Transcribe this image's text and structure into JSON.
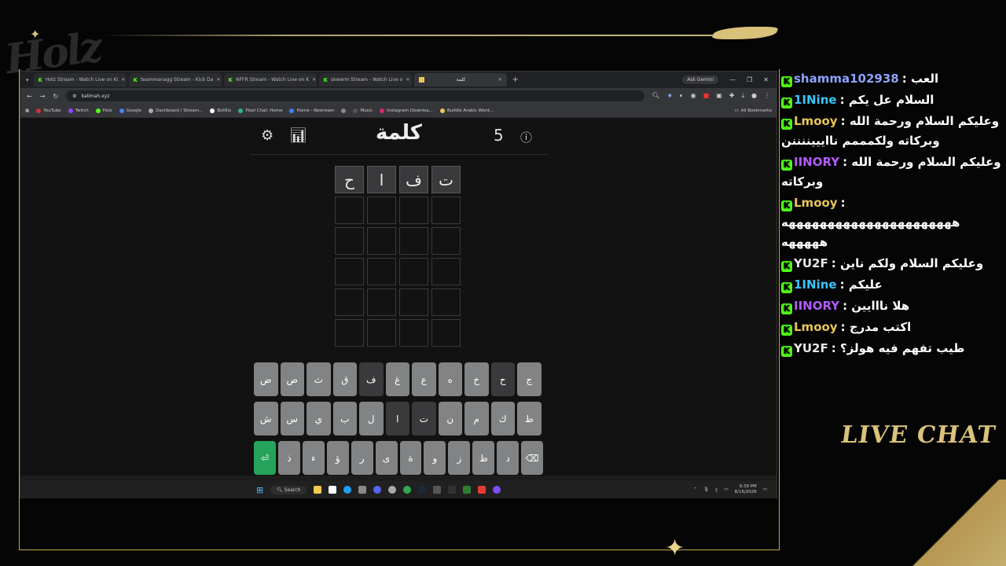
{
  "browser": {
    "tabs": [
      {
        "label": "Holz Stream - Watch Live on Ki",
        "active": false
      },
      {
        "label": "teammanagg Stream - Kick Da",
        "active": false
      },
      {
        "label": "NFFR Stream - Watch Live on K",
        "active": false
      },
      {
        "label": "skwerm Stream - Watch Live o",
        "active": false
      },
      {
        "label": "كلمة",
        "active": true
      }
    ],
    "gemini_label": "Ask Gemini",
    "url": "kalimah.xyz",
    "bookmarks": [
      "YouTube",
      "Twitch",
      "Holz",
      "Google",
      "Dashboard / Stream...",
      "BotRix",
      "Pixel Chat: Home",
      "Home - Restream",
      "Music",
      "Instagram Downloa...",
      "Buildle Arabic Word..."
    ],
    "all_bookmarks": "All Bookmarks"
  },
  "game": {
    "title": "كلمة",
    "count": "5",
    "settings_icon": "gear-icon",
    "stats_icon": "chart-icon",
    "help_icon": "help-icon",
    "board": [
      [
        "ح",
        "ا",
        "ف",
        "ت"
      ],
      [
        "",
        "",
        "",
        ""
      ],
      [
        "",
        "",
        "",
        ""
      ],
      [
        "",
        "",
        "",
        ""
      ],
      [
        "",
        "",
        "",
        ""
      ],
      [
        "",
        "",
        "",
        ""
      ]
    ],
    "keyboard": [
      [
        {
          "k": "ض"
        },
        {
          "k": "ص"
        },
        {
          "k": "ث"
        },
        {
          "k": "ق"
        },
        {
          "k": "ف",
          "dark": true
        },
        {
          "k": "غ"
        },
        {
          "k": "ع"
        },
        {
          "k": "ه"
        },
        {
          "k": "خ"
        },
        {
          "k": "ح",
          "dark": true
        },
        {
          "k": "ج"
        }
      ],
      [
        {
          "k": "ش"
        },
        {
          "k": "س"
        },
        {
          "k": "ي"
        },
        {
          "k": "ب"
        },
        {
          "k": "ل"
        },
        {
          "k": "ا",
          "dark": true
        },
        {
          "k": "ت",
          "dark": true
        },
        {
          "k": "ن"
        },
        {
          "k": "م"
        },
        {
          "k": "ك"
        },
        {
          "k": "ط"
        }
      ],
      [
        {
          "k": "⏎",
          "enter": true
        },
        {
          "k": "ذ"
        },
        {
          "k": "ء"
        },
        {
          "k": "ؤ"
        },
        {
          "k": "ر"
        },
        {
          "k": "ى"
        },
        {
          "k": "ة"
        },
        {
          "k": "و"
        },
        {
          "k": "ز"
        },
        {
          "k": "ظ"
        },
        {
          "k": "د"
        },
        {
          "k": "⌫"
        }
      ]
    ]
  },
  "taskbar": {
    "search": "Search",
    "lang": "ع",
    "time": "9:39 PM",
    "date": "8/16/2026"
  },
  "chat": {
    "title": "LIVE CHAT",
    "messages": [
      {
        "user": "shamma102938",
        "color": "#8ea4ff",
        "text": "العب"
      },
      {
        "user": "1INine",
        "color": "#39c5ff",
        "text": "السلام عل يكم"
      },
      {
        "user": "Lmooy",
        "color": "#e8c65a",
        "text": "وعليكم السلام ورحمة الله وبركاته ولكمممم ناايييننننن"
      },
      {
        "user": "IINORY",
        "color": "#b35cff",
        "text": "وعليكم السلام ورحمة الله وبركاته"
      },
      {
        "user": "Lmooy",
        "color": "#e8c65a",
        "text": "ههههههههههههههههههههههه هههههه"
      },
      {
        "user": "YU2F",
        "color": "#e8e8e8",
        "text": "وعليكم السلام ولكم ناين"
      },
      {
        "user": "1INine",
        "color": "#39c5ff",
        "text": "عليكم"
      },
      {
        "user": "IINORY",
        "color": "#b35cff",
        "text": "هلا نااايين"
      },
      {
        "user": "Lmooy",
        "color": "#e8c65a",
        "text": "اكتب مدرج"
      },
      {
        "user": "YU2F",
        "color": "#e8e8e8",
        "text": "طيب تفهم فيه هولز؟"
      }
    ]
  },
  "overlay": {
    "logo": "Holz"
  }
}
